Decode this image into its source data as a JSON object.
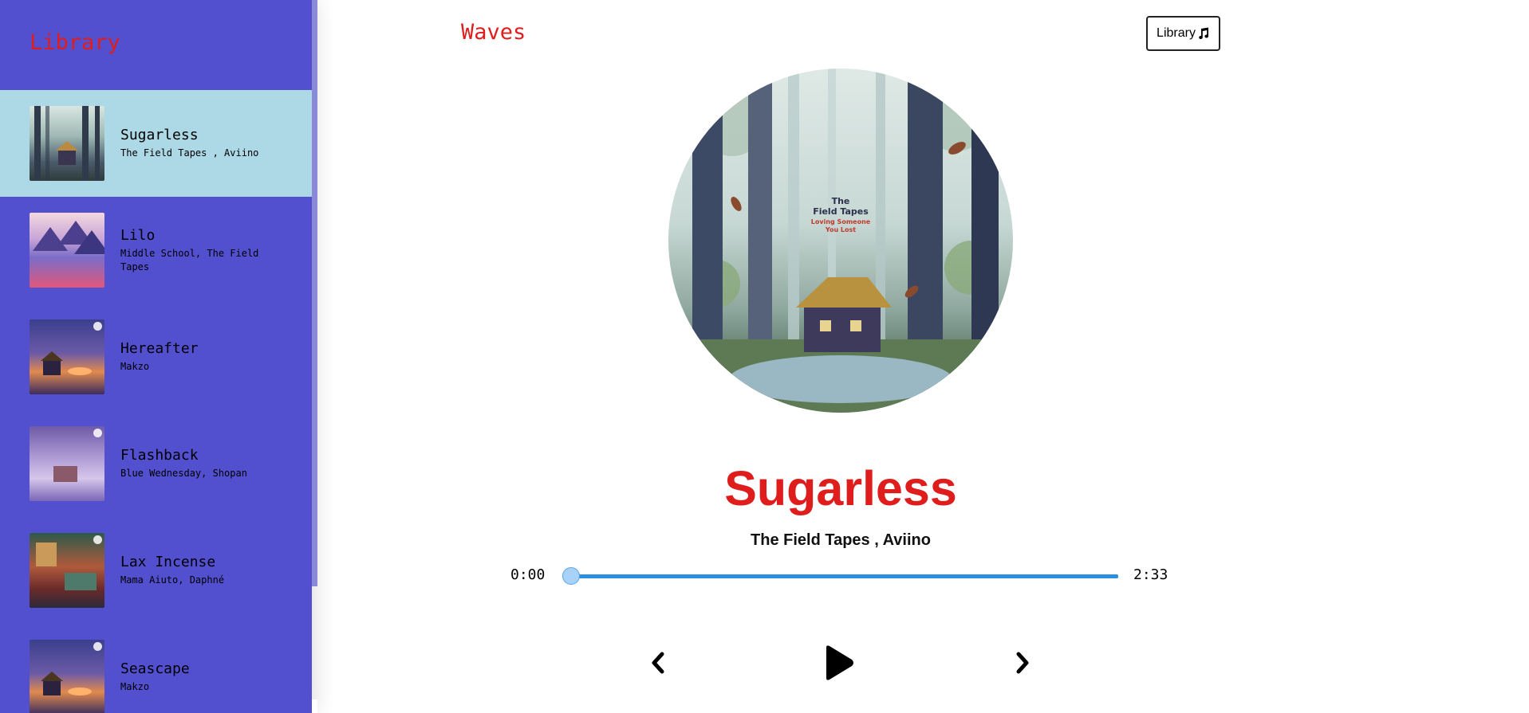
{
  "sidebar": {
    "title": "Library",
    "songs": [
      {
        "name": "Sugarless",
        "artist": "The Field Tapes , Aviino",
        "cover": "forest-cabin-art",
        "selected": true
      },
      {
        "name": "Lilo",
        "artist": "Middle School, The Field Tapes",
        "cover": "mountain-lake-art",
        "selected": false
      },
      {
        "name": "Hereafter",
        "artist": "Makzo",
        "cover": "sunset-cabin-art",
        "selected": false
      },
      {
        "name": "Flashback",
        "artist": "Blue Wednesday, Shopan",
        "cover": "snowy-room-art",
        "selected": false
      },
      {
        "name": "Lax Incense",
        "artist": "Mama Aiuto, Daphné",
        "cover": "cozy-room-art",
        "selected": false
      },
      {
        "name": "Seascape",
        "artist": "Makzo",
        "cover": "sunset-cabin-art",
        "selected": false
      }
    ]
  },
  "header": {
    "app_title": "Waves",
    "library_button_label": "Library",
    "library_button_icon": "music-note-icon"
  },
  "player": {
    "artwork_lettering": [
      "The",
      "Field Tapes",
      "Loving Someone",
      "You Lost"
    ],
    "title": "Sugarless",
    "artist": "The Field Tapes , Aviino",
    "current_time": "0:00",
    "total_time": "2:33",
    "progress_fraction": 0.0,
    "controls": {
      "prev_icon": "chevron-left-icon",
      "play_icon": "play-icon",
      "next_icon": "chevron-right-icon"
    }
  },
  "colors": {
    "sidebar_bg": "#5350cf",
    "selected_item_bg": "#add8e6",
    "accent_red": "#e01d1d",
    "progress_blue": "#2a8fe0"
  }
}
